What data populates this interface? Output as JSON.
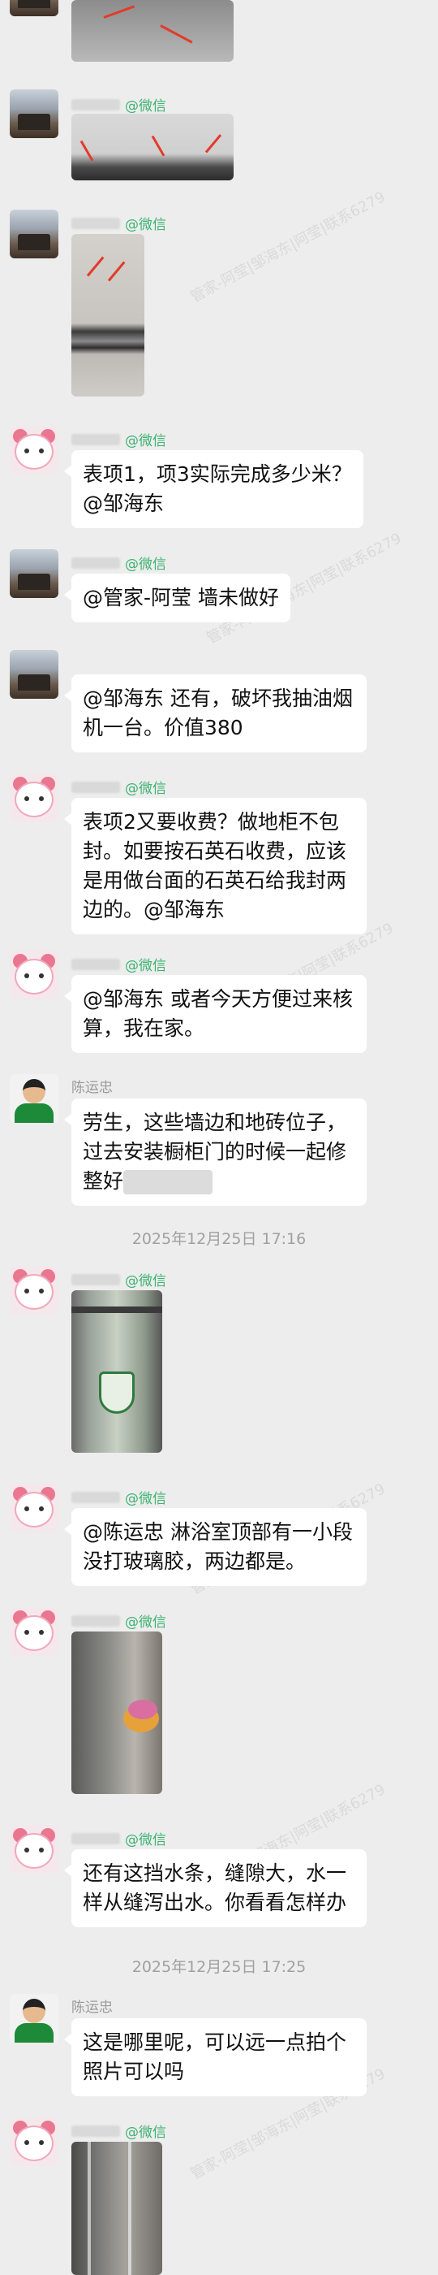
{
  "colors": {
    "background": "#ededed",
    "bubble": "#ffffff",
    "wechat_tag": "#3cb371",
    "text": "#111111",
    "meta": "#a0a0a0"
  },
  "wechat_tag": "@微信",
  "messages": [
    {
      "type": "image",
      "avatar": "house",
      "desc": "wall-photo-arrows"
    },
    {
      "type": "image",
      "avatar": "house",
      "show_tag": true,
      "desc": "ceiling-photo-arrows"
    },
    {
      "type": "image",
      "avatar": "house",
      "show_tag": true,
      "desc": "cabinet-edge-photo"
    },
    {
      "type": "text",
      "avatar": "girl",
      "text": "表项1，项3实际完成多少米？@邹海东"
    },
    {
      "type": "text",
      "avatar": "house",
      "text": "@管家-阿莹 墙未做好"
    },
    {
      "type": "text",
      "avatar": "house",
      "text": "@邹海东 还有，破坏我抽油烟机一台。价值380"
    },
    {
      "type": "text",
      "avatar": "girl",
      "text": "表项2又要收费？做地柜不包封。如要按石英石收费，应该是用做台面的石英石给我封两边的。@邹海东"
    },
    {
      "type": "text",
      "avatar": "girl",
      "text": "@邹海东 或者今天方便过来核算，我在家。"
    },
    {
      "type": "text",
      "avatar": "man",
      "sender": "陈运忠",
      "text": "劳生，这些墙边和地砖位子，过去安装橱柜门的时候一起修整好"
    },
    {
      "type": "image",
      "avatar": "girl",
      "desc": "shower-glass-photo"
    },
    {
      "type": "text",
      "avatar": "girl",
      "text": "@陈运忠 淋浴室顶部有一小段没打玻璃胶，两边都是。"
    },
    {
      "type": "image",
      "avatar": "girl",
      "desc": "shower-corner-photo"
    },
    {
      "type": "text",
      "avatar": "girl",
      "text": "还有这挡水条，缝隙大，水一样从缝泻出水。你看看怎样办"
    },
    {
      "type": "text",
      "avatar": "man",
      "sender": "陈运忠",
      "text": "这是哪里呢，可以远一点拍个照片可以吗"
    },
    {
      "type": "image",
      "avatar": "girl",
      "desc": "shower-door-photo"
    }
  ],
  "timestamps": [
    "2025年12月25日 17:16",
    "2025年12月25日 17:25"
  ],
  "watermark": "管家-阿莹|邹海东|阿莹|联系6279"
}
